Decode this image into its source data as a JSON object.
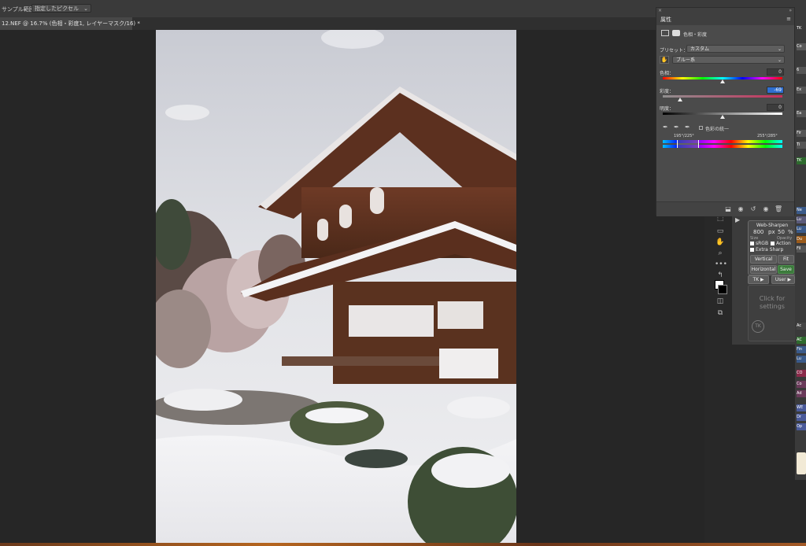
{
  "options_bar": {
    "sample_label": "サンプル範囲：",
    "sample_value": "指定したピクセル"
  },
  "document_tab": {
    "title": "12.NEF @ 16.7% (色相・彩度1, レイヤーマスク/16) *"
  },
  "properties_panel": {
    "tab_label": "属性",
    "adjustment_name": "色相・彩度",
    "preset_label": "プリセット：",
    "preset_value": "カスタム",
    "channel_value": "ブルー系",
    "hue_label": "色相：",
    "hue_value": "0",
    "saturation_label": "彩度：",
    "saturation_value": "-69",
    "lightness_label": "明度：",
    "lightness_value": "0",
    "colorize_label": "色彩の統一",
    "range_left": "195°/225°",
    "range_right": "255°/285°"
  },
  "tk_panel": {
    "title": "Web-Sharpen",
    "size_value": "800",
    "size_unit": "px",
    "opacity_value": "50",
    "opacity_unit": "%",
    "size_label": "Size",
    "opacity_label": "Opacity",
    "srgb_label": "sRGB",
    "action_label": "Action",
    "extra_sharp_label": "Extra Sharp",
    "vertical_label": "Vertical",
    "fit_label": "Fit",
    "horizontal_label": "Horizontal",
    "save_label": "Save",
    "tk_button": "TK ▶",
    "user_button": "User ▶",
    "click_settings": "Click for settings",
    "tk_logo": "TK"
  },
  "right_column_labels": [
    "TK",
    "Co",
    "6",
    "Ex",
    "Ea",
    "Fir",
    "Ti",
    "TK",
    "Lu",
    "Ne",
    "Lu",
    "Du",
    "Fil",
    "Ac",
    "AC",
    "Fin",
    "Lu",
    "CO",
    "Co",
    "Ad",
    "WE",
    "Dr",
    "Op"
  ],
  "colors": {
    "app_bg": "#282828",
    "panel_bg": "#4b4b4b",
    "accent_blue": "#2f6fd1",
    "save_green": "#3b7a3b"
  }
}
